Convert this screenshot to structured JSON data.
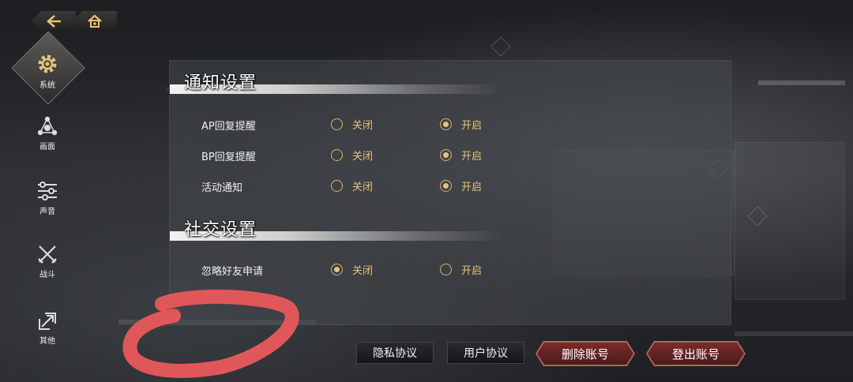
{
  "nav": {
    "back_icon": "back-arrow-icon",
    "home_icon": "home-icon"
  },
  "sidebar": {
    "items": [
      {
        "label": "系统",
        "icon": "gear-icon",
        "active": true
      },
      {
        "label": "画面",
        "icon": "graph-nodes-icon"
      },
      {
        "label": "声音",
        "icon": "sliders-icon"
      },
      {
        "label": "战斗",
        "icon": "crossed-swords-icon"
      },
      {
        "label": "其他",
        "icon": "expand-arrow-icon"
      }
    ]
  },
  "notifications": {
    "title": "通知设置",
    "rows": [
      {
        "label": "AP回复提醒",
        "off_label": "关闭",
        "on_label": "开启",
        "selected": "on"
      },
      {
        "label": "BP回复提醒",
        "off_label": "关闭",
        "on_label": "开启",
        "selected": "on"
      },
      {
        "label": "活动通知",
        "off_label": "关闭",
        "on_label": "开启",
        "selected": "on"
      }
    ]
  },
  "social": {
    "title": "社交设置",
    "rows": [
      {
        "label": "忽略好友申请",
        "off_label": "关闭",
        "on_label": "开启",
        "selected": "off"
      }
    ]
  },
  "footer": {
    "privacy_label": "隐私协议",
    "user_agreement_label": "用户协议",
    "delete_account_label": "删除账号",
    "logout_label": "登出账号"
  },
  "colors": {
    "accent_gold": "#e6c27a",
    "danger_red": "#7b2a2a",
    "annotation_red": "#e0575a"
  }
}
